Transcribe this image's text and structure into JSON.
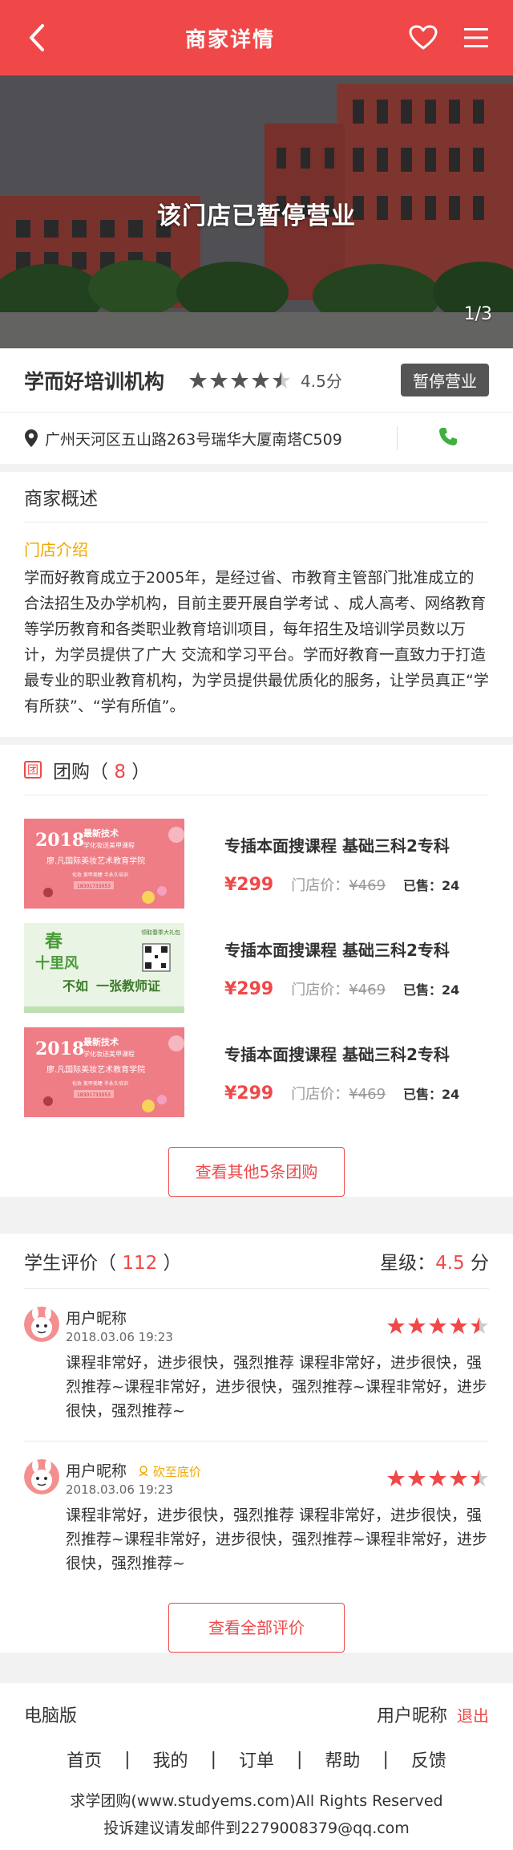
{
  "header": {
    "title": "商家详情",
    "back_icon": "back-arrow-icon",
    "fav_icon": "heart-icon",
    "menu_icon": "menu-icon"
  },
  "banner": {
    "closed_text": "该门店已暂停营业",
    "counter": "1/3"
  },
  "shop": {
    "name": "学而好培训机构",
    "rating": 4.5,
    "rating_text": "4.5分",
    "status": "暂停营业",
    "address": "广州天河区五山路263号瑞华大厦南塔C509",
    "colors": {
      "accent": "#f04848",
      "phone": "#3cb043",
      "status_bg": "#555555"
    }
  },
  "overview": {
    "title": "商家概述",
    "intro_label": "门店介绍",
    "intro_text": "学而好教育成立于2005年，是经过省、市教育主管部门批准成立的合法招生及办学机构，目前主要开展自学考试 、成人高考、网络教育等学历教育和各类职业教育培训项目，每年招生及培训学员数以万计，为学员提供了广大 交流和学习平台。学而好教育一直致力于打造最专业的职业教育机构，为学员提供最优质化的服务，让学员真正“学有所获”、“学有所值”。"
  },
  "group": {
    "icon_char": "团",
    "title": "团购",
    "count": "8",
    "deals": [
      {
        "name": "专插本面搜课程 基础三科2专科",
        "price": "¥299",
        "store_label": "门店价：",
        "store_price": "¥469",
        "sold": "已售：24",
        "img": "banner-pink-makeup"
      },
      {
        "name": "专插本面搜课程 基础三科2专科",
        "price": "¥299",
        "store_label": "门店价：",
        "store_price": "¥469",
        "sold": "已售：24",
        "img": "banner-green-teacher"
      },
      {
        "name": "专插本面搜课程 基础三科2专科",
        "price": "¥299",
        "store_label": "门店价：",
        "store_price": "¥469",
        "sold": "已售：24",
        "img": "banner-pink-makeup"
      }
    ],
    "more_button": "查看其他5条团购"
  },
  "reviews": {
    "title": "学生评价",
    "count": "112",
    "star_label": "星级：",
    "star_value": "4.5",
    "star_unit": "分",
    "items": [
      {
        "nick": "用户昵称",
        "tag": "",
        "date": "2018.03.06  19:23",
        "rating": 4.5,
        "text": "课程非常好，进步很快，强烈推荐  课程非常好，进步很快，强烈推荐~课程非常好，进步很快，强烈推荐~课程非常好，进步很快，强烈推荐~"
      },
      {
        "nick": "用户昵称",
        "tag": "砍至底价",
        "date": "2018.03.06  19:23",
        "rating": 4.5,
        "text": "课程非常好，进步很快，强烈推荐  课程非常好，进步很快，强烈推荐~课程非常好，进步很快，强烈推荐~课程非常好，进步很快，强烈推荐~"
      }
    ],
    "all_button": "查看全部评价"
  },
  "footer": {
    "pc_version": "电脑版",
    "user": "用户昵称",
    "logout": "退出",
    "nav": [
      "首页",
      "我的",
      "订单",
      "帮助",
      "反馈"
    ],
    "nav_sep": "|",
    "copyright": "求学团购(www.studyems.com)All Rights Reserved",
    "contact": "投诉建议请发邮件到2279008379@qq.com"
  },
  "deal_images": {
    "pink": {
      "year": "2018",
      "line1": "最新技术",
      "line2": "学化妆送美甲课程",
      "line3": "廖.凡国际美妆艺术教育学院",
      "line4": "化妆 美甲美睫 半永久培训",
      "phone": "18301733053"
    },
    "green": {
      "w1": "春",
      "w2": "十里风",
      "w3": "不如",
      "w4": "一张教师证",
      "side": "领取春季大礼包"
    }
  }
}
